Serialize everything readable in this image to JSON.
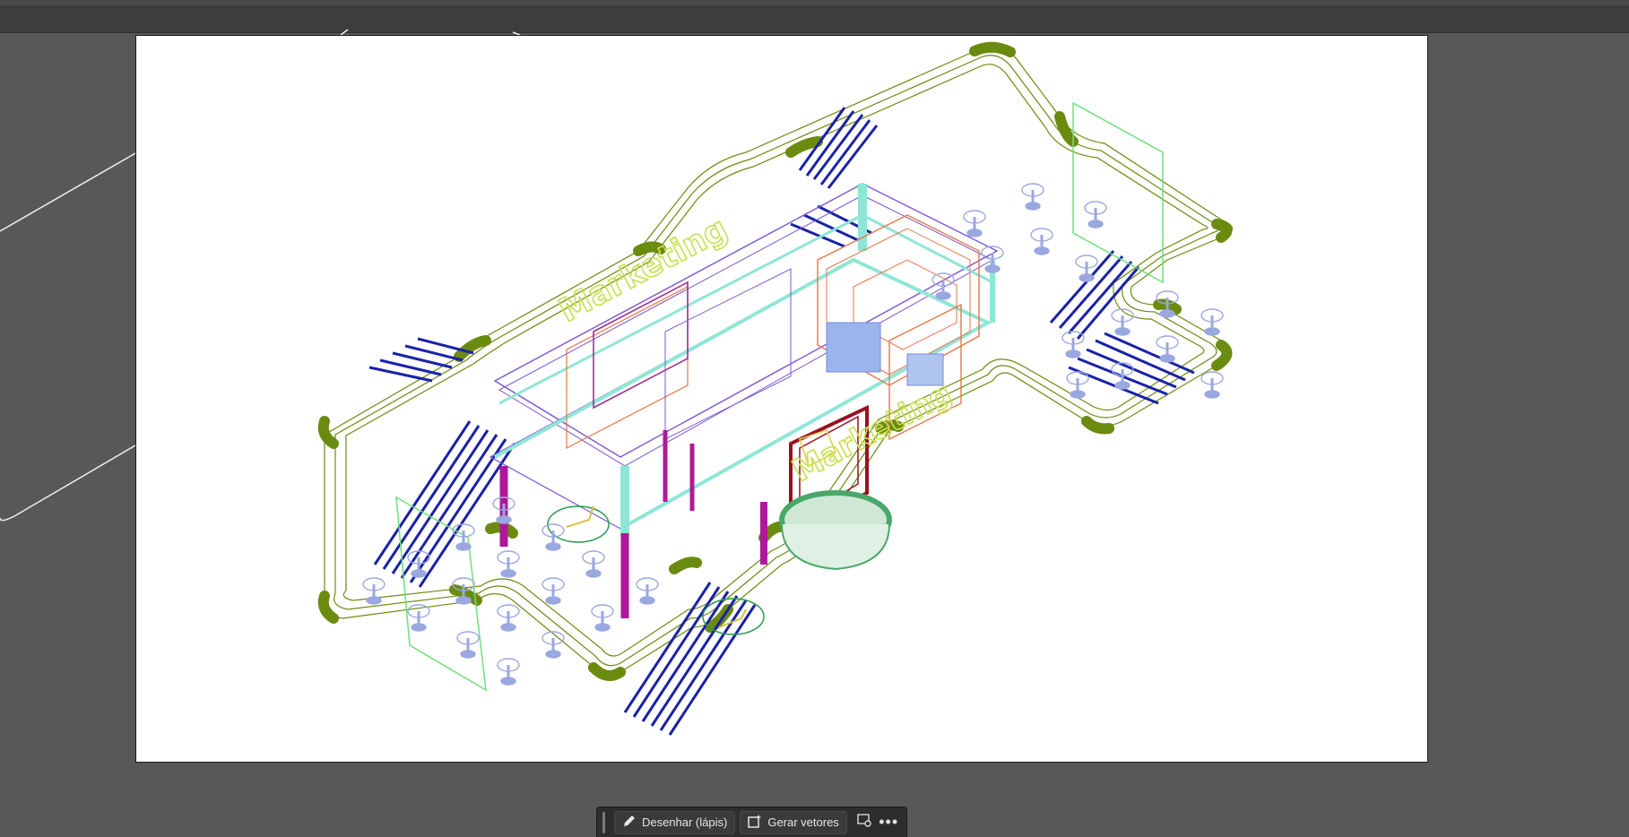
{
  "contextual_taskbar": {
    "draw_label": "Desenhar (lápis)",
    "vectorize_label": "Gerar vetores",
    "draw_icon": "pencil-icon",
    "vectorize_icon": "generate-vectors-icon",
    "image_settings_icon": "image-settings-icon",
    "more_icon": "more-options-icon"
  },
  "artwork": {
    "text_left": "Marketing",
    "text_right": "Marketing",
    "colors": {
      "track": "#6b8a10",
      "ramp_stripe": "#1a22a8",
      "cyan": "#8fe6d6",
      "purple": "#7a55d8",
      "orange": "#e8764a",
      "magenta": "#b0189a",
      "darkred": "#9a1020",
      "green": "#4aa86a",
      "text_yellow": "#c8e050",
      "stool": "#9aa8e0"
    }
  }
}
